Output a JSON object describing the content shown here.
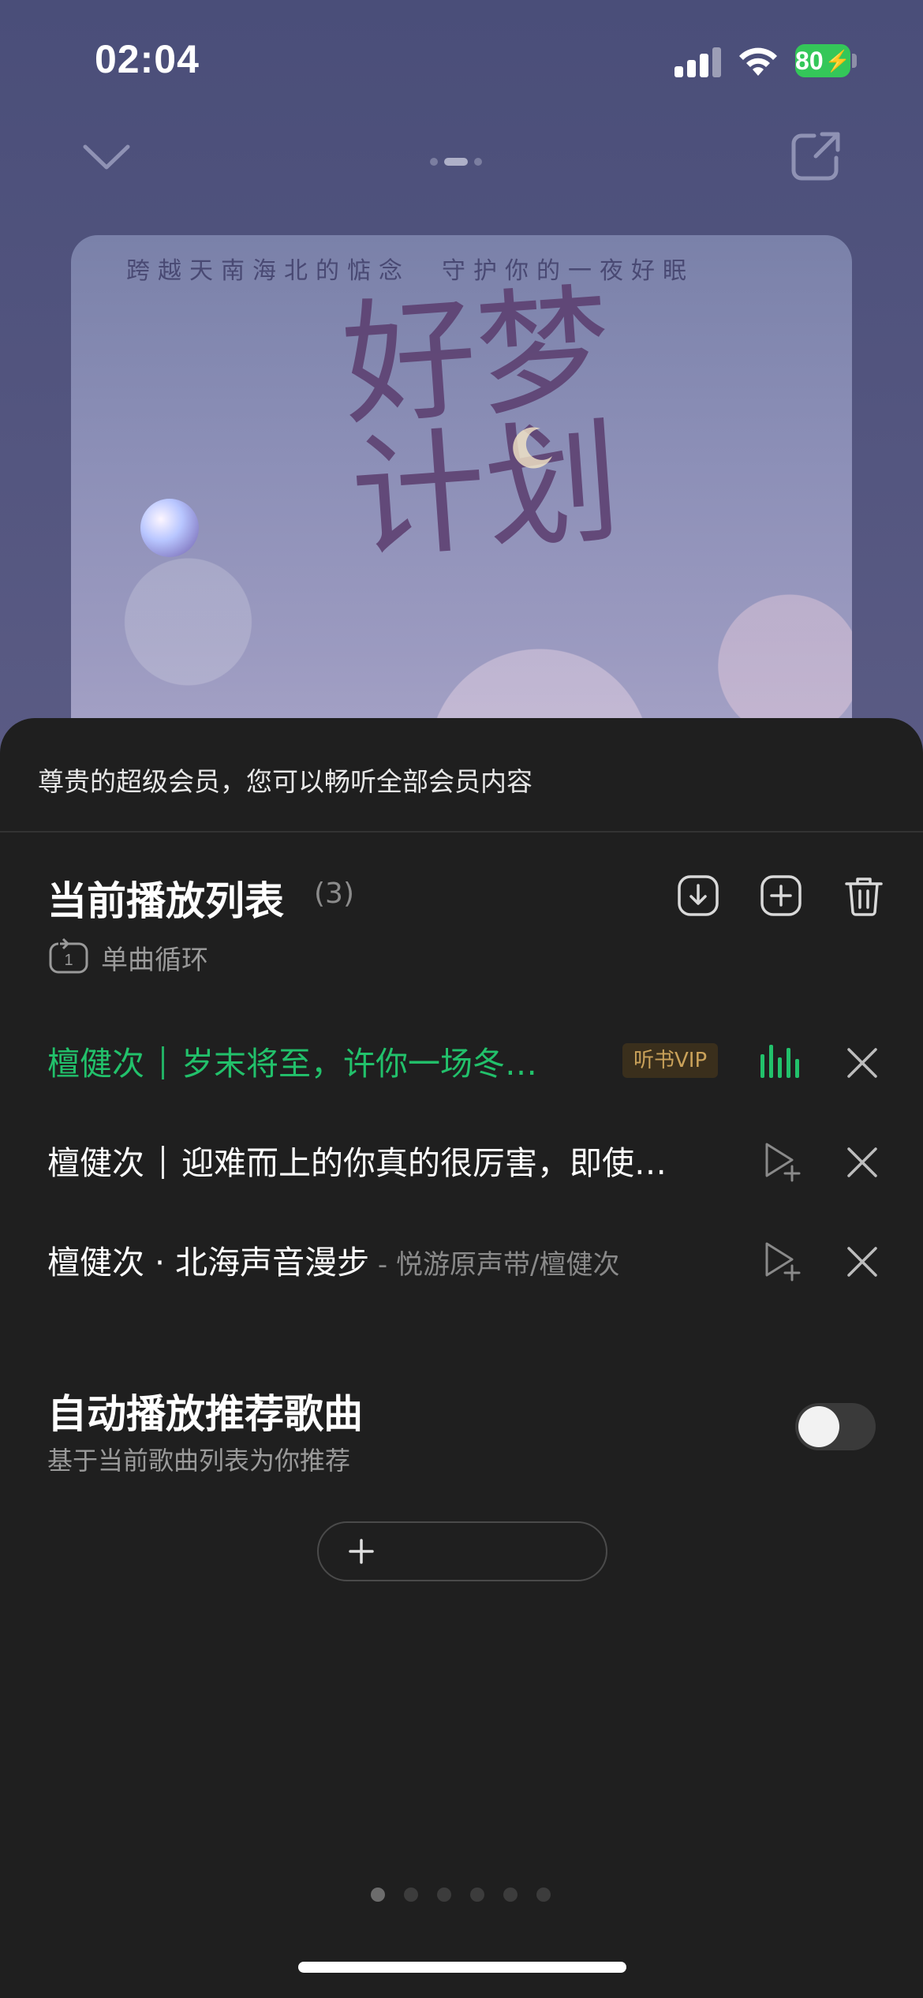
{
  "status_bar": {
    "time": "02:04",
    "battery": "80"
  },
  "cover": {
    "slogan": "跨越天南海北的惦念　守护你的一夜好眠",
    "title": "好梦计划"
  },
  "sheet": {
    "vip_banner": "尊贵的超级会员，您可以畅听全部会员内容",
    "playlist_title": "当前播放列表",
    "playlist_count": "(3)",
    "loop_mode": "单曲循环",
    "tracks": [
      {
        "artist": "檀健次",
        "title": "岁末将至，许你一场冬…",
        "badge": "听书VIP",
        "playing": true
      },
      {
        "artist": "檀健次",
        "title": "迎难而上的你真的很厉害，即使…",
        "playing": false
      },
      {
        "title": "檀健次 · 北海声音漫步",
        "subtitle": " - 悦游原声带/檀健次",
        "playing": false
      }
    ],
    "autoplay": {
      "title": "自动播放推荐歌曲",
      "desc": "基于当前歌曲列表为你推荐",
      "enabled": false
    }
  },
  "colors": {
    "accent_green": "#22c16b",
    "sheet_bg": "#1f1f1f",
    "vip_gold": "#caa25a"
  }
}
